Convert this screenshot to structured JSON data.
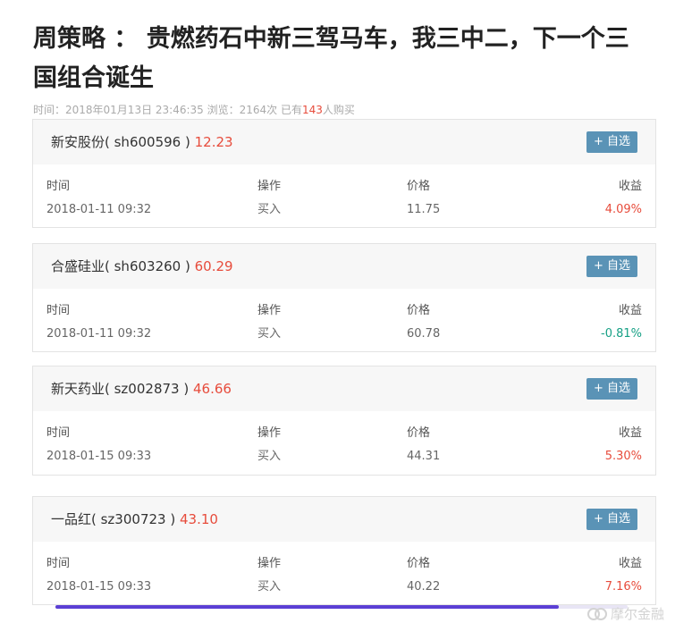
{
  "article": {
    "title": "周策略 ： 贵燃药石中新三驾马车，我三中二，下一个三国组合诞生",
    "meta_prefix": "时间：2018年01月13日 23:46:35  浏览：2164次  已有",
    "meta_count": "143",
    "meta_suffix": "人购买"
  },
  "table_headers": {
    "time": "时间",
    "action": "操作",
    "price": "价格",
    "return": "收益"
  },
  "add_button_label": "+ 自选",
  "cards": [
    {
      "name": "新安股份( sh600596 )",
      "price": "12.23",
      "time": "2018-01-11 09:32",
      "action": "买入",
      "buy_price": "11.75",
      "return": "4.09%"
    },
    {
      "name": "合盛硅业( sh603260 )",
      "price": "60.29",
      "time": "2018-01-11 09:32",
      "action": "买入",
      "buy_price": "60.78",
      "return": "-0.81%"
    },
    {
      "name": "新天药业( sz002873 )",
      "price": "46.66",
      "time": "2018-01-15 09:33",
      "action": "买入",
      "buy_price": "44.31",
      "return": "5.30%"
    },
    {
      "name": "一品红( sz300723 )",
      "price": "43.10",
      "time": "2018-01-15 09:33",
      "action": "买入",
      "buy_price": "40.22",
      "return": "7.16%"
    }
  ],
  "progress": 0.88,
  "watermark": "摩尔金融",
  "colors": {
    "up": "#e74c3c",
    "down": "#16a085",
    "button": "#5a93b6",
    "progress": "#5b3fd4"
  }
}
